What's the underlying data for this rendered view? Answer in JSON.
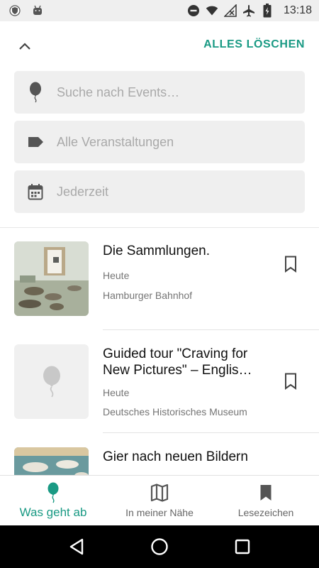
{
  "status_bar": {
    "time": "13:18",
    "left_icons": [
      "vpn-shield-icon",
      "android-robot-icon"
    ],
    "right_icons": [
      "do-not-disturb-icon",
      "wifi-icon",
      "no-signal-icon",
      "airplane-icon",
      "battery-icon"
    ]
  },
  "filter": {
    "clear_label": "ALLES LÖSCHEN",
    "search_placeholder": "Suche nach Events…",
    "category_placeholder": "Alle Veranstaltungen",
    "date_placeholder": "Jederzeit"
  },
  "events": [
    {
      "title": "Die Sammlungen.",
      "date": "Heute",
      "venue": "Hamburger Bahnhof",
      "has_image": true
    },
    {
      "title": "Guided tour \"Craving for New Pictures\" – Englis…",
      "date": "Heute",
      "venue": "Deutsches Historisches Museum",
      "has_image": false
    },
    {
      "title": "Gier nach neuen Bildern",
      "date": "",
      "venue": "",
      "has_image": true
    }
  ],
  "bottom_nav": {
    "items": [
      {
        "label": "Was geht ab",
        "icon": "balloon-icon",
        "active": true
      },
      {
        "label": "In meiner Nähe",
        "icon": "map-icon",
        "active": false
      },
      {
        "label": "Lesezeichen",
        "icon": "bookmark-filled-icon",
        "active": false
      }
    ]
  },
  "colors": {
    "accent": "#1a9a84",
    "field_bg": "#efefef",
    "placeholder": "#a9a9a9",
    "icon_gray": "#555555"
  }
}
